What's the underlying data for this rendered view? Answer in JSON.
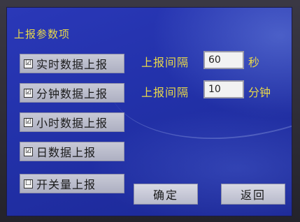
{
  "title": "上报参数项",
  "checkboxes": [
    {
      "label": "实时数据上报",
      "checked": true,
      "mark": "☑"
    },
    {
      "label": "分钟数据上报",
      "checked": true,
      "mark": "☑"
    },
    {
      "label": "小时数据上报",
      "checked": true,
      "mark": "☑"
    },
    {
      "label": "日数据上报",
      "checked": true,
      "mark": "☑"
    },
    {
      "label": "开关量上报",
      "checked": false,
      "mark": "☐"
    }
  ],
  "intervals": [
    {
      "label": "上报间隔",
      "value": "60",
      "unit": "秒"
    },
    {
      "label": "上报间隔",
      "value": "10",
      "unit": "分钟"
    }
  ],
  "buttons": {
    "confirm": "确定",
    "back": "返回"
  },
  "colors": {
    "accent_text": "#e8d84a",
    "background": "#2231a9"
  }
}
